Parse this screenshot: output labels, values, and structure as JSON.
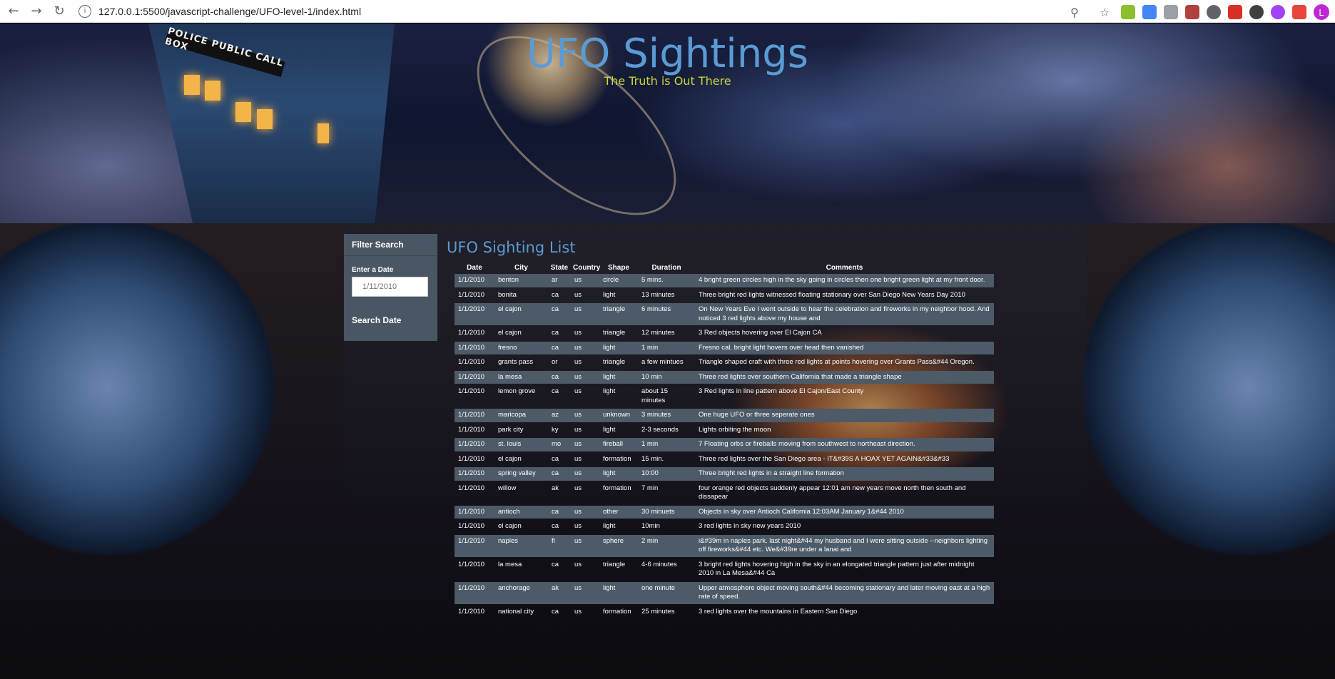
{
  "browser": {
    "url": "127.0.0.1:5500/javascript-challenge/UFO-level-1/index.html",
    "avatar_letter": "L"
  },
  "header": {
    "title": "UFO Sightings",
    "subtitle": "The Truth is Out There",
    "tardis_sign": "POLICE PUBLIC CALL BOX"
  },
  "filter": {
    "heading": "Filter Search",
    "date_label": "Enter a Date",
    "date_placeholder": "1/11/2010",
    "button_label": "Search Date"
  },
  "table": {
    "title": "UFO Sighting List",
    "columns": [
      "Date",
      "City",
      "State",
      "Country",
      "Shape",
      "Duration",
      "Comments"
    ],
    "rows": [
      [
        "1/1/2010",
        "benton",
        "ar",
        "us",
        "circle",
        "5 mins.",
        "4 bright green circles high in the sky going in circles then one bright green light at my front door."
      ],
      [
        "1/1/2010",
        "bonita",
        "ca",
        "us",
        "light",
        "13 minutes",
        "Three bright red lights witnessed floating stationary over San Diego New Years Day 2010"
      ],
      [
        "1/1/2010",
        "el cajon",
        "ca",
        "us",
        "triangle",
        "6 minutes",
        "On New Years Eve I went outside to hear the celebration and fireworks in my neighbor hood. And noticed 3 red lights above my house and"
      ],
      [
        "1/1/2010",
        "el cajon",
        "ca",
        "us",
        "triangle",
        "12 minutes",
        "3 Red objects hovering over El Cajon CA"
      ],
      [
        "1/1/2010",
        "fresno",
        "ca",
        "us",
        "light",
        "1 min",
        "Fresno cal. bright light hovers over head then vanished"
      ],
      [
        "1/1/2010",
        "grants pass",
        "or",
        "us",
        "triangle",
        "a few mintues",
        "Triangle shaped craft with three red lights at points hovering over Grants Pass&#44 Oregon."
      ],
      [
        "1/1/2010",
        "la mesa",
        "ca",
        "us",
        "light",
        "10 min",
        "Three red lights over southern California that made a triangle shape"
      ],
      [
        "1/1/2010",
        "lemon grove",
        "ca",
        "us",
        "light",
        "about 15 minutes",
        "3 Red lights in line pattern above El Cajon/East County"
      ],
      [
        "1/1/2010",
        "maricopa",
        "az",
        "us",
        "unknown",
        "3 minutes",
        "One huge UFO or three seperate ones"
      ],
      [
        "1/1/2010",
        "park city",
        "ky",
        "us",
        "light",
        "2-3 seconds",
        "Lights orbiting the moon"
      ],
      [
        "1/1/2010",
        "st. louis",
        "mo",
        "us",
        "fireball",
        "1 min",
        "7 Floating orbs or fireballs moving from southwest to northeast direction."
      ],
      [
        "1/1/2010",
        "el cajon",
        "ca",
        "us",
        "formation",
        "15 min.",
        "Three red lights over the San Diego area - IT&#39S A HOAX YET AGAIN&#33&#33"
      ],
      [
        "1/1/2010",
        "spring valley",
        "ca",
        "us",
        "light",
        "10:00",
        "Three bright red lights in a straight line formation"
      ],
      [
        "1/1/2010",
        "willow",
        "ak",
        "us",
        "formation",
        "7 min",
        "four orange red objects suddenly appear 12:01 am new years move north then south and dissapear"
      ],
      [
        "1/1/2010",
        "antioch",
        "ca",
        "us",
        "other",
        "30 minuets",
        "Objects in sky over Antioch California 12:03AM January 1&#44 2010"
      ],
      [
        "1/1/2010",
        "el cajon",
        "ca",
        "us",
        "light",
        "10min",
        "3 red lights in sky new years 2010"
      ],
      [
        "1/1/2010",
        "naples",
        "fl",
        "us",
        "sphere",
        "2 min",
        "i&#39m in naples park. last night&#44 my husband and I were sitting outside --neighbors lighting off fireworks&#44 etc. We&#39re under a lanai and"
      ],
      [
        "1/1/2010",
        "la mesa",
        "ca",
        "us",
        "triangle",
        "4-6 minutes",
        "3 bright red lights hovering high in the sky in an elongated triangle pattern just after midnight 2010 in La Mesa&#44 Ca"
      ],
      [
        "1/1/2010",
        "anchorage",
        "ak",
        "us",
        "light",
        "one minute",
        "Upper atmosphere object moving south&#44 becoming stationary and later moving east at a high rate of speed."
      ],
      [
        "1/1/2010",
        "national city",
        "ca",
        "us",
        "formation",
        "25 minutes",
        "3 red lights over the mountains in Eastern San Diego"
      ]
    ]
  }
}
